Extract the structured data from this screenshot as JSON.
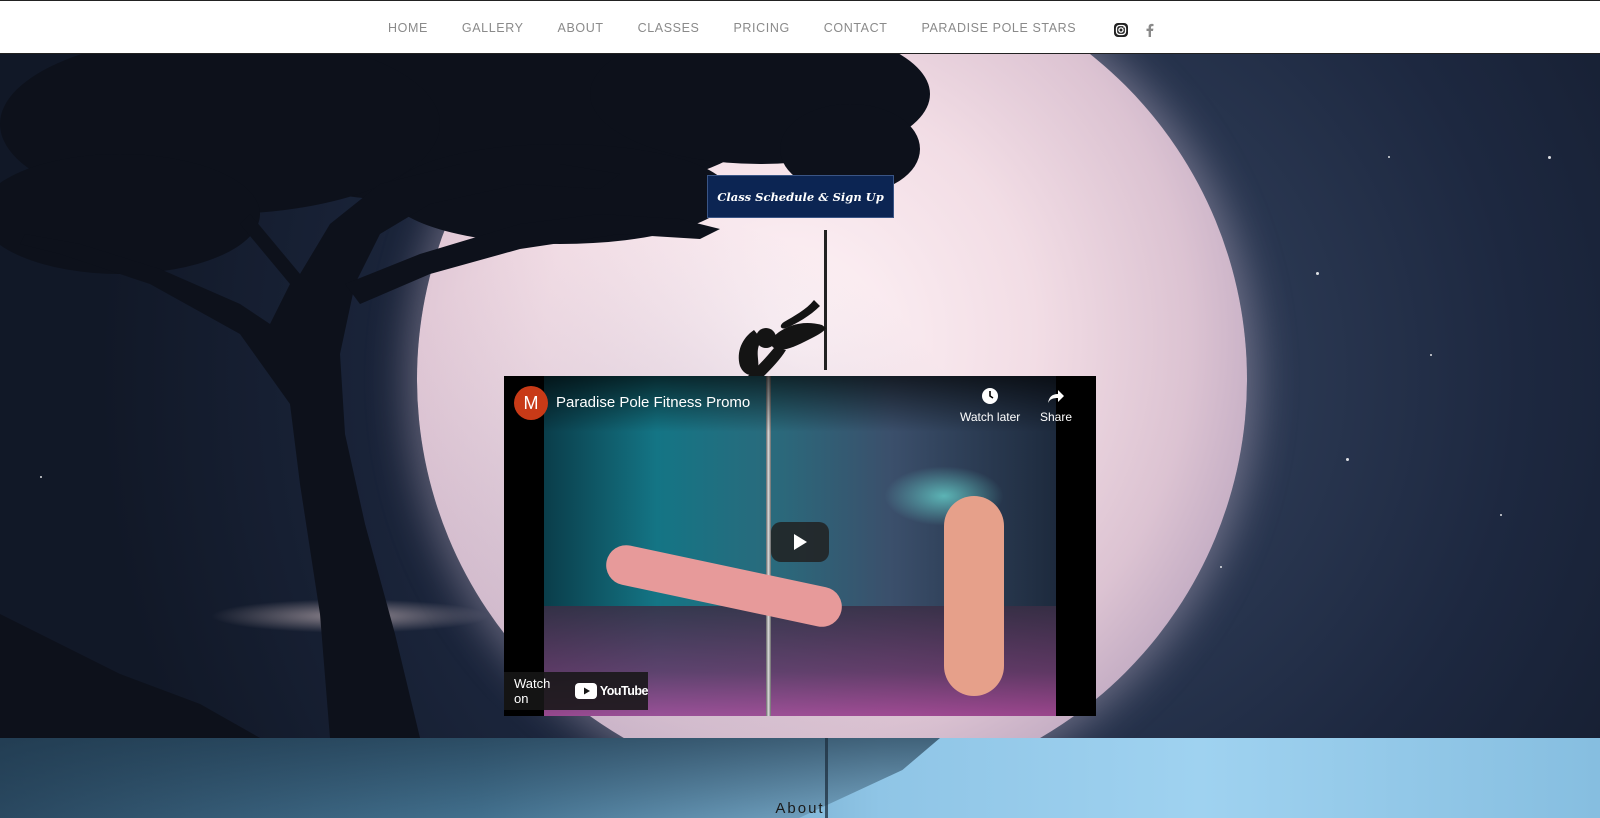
{
  "nav": {
    "items": [
      "HOME",
      "GALLERY",
      "ABOUT",
      "CLASSES",
      "PRICING",
      "CONTACT",
      "PARADISE POLE STARS"
    ]
  },
  "social": {
    "icons": [
      "instagram-icon",
      "facebook-icon"
    ]
  },
  "hero": {
    "cta_label": "Class Schedule & Sign Up"
  },
  "video": {
    "channel_initial": "M",
    "title": "Paradise Pole Fitness Promo",
    "watch_later_label": "Watch later",
    "share_label": "Share",
    "watch_on_label": "Watch on",
    "youtube_label": "YouTube"
  },
  "section": {
    "about_title": "About"
  },
  "colors": {
    "cta_background": "#0c2553",
    "nav_text": "#8a8a8a",
    "avatar": "#c83a17",
    "youtube_red": "#ff0000"
  }
}
